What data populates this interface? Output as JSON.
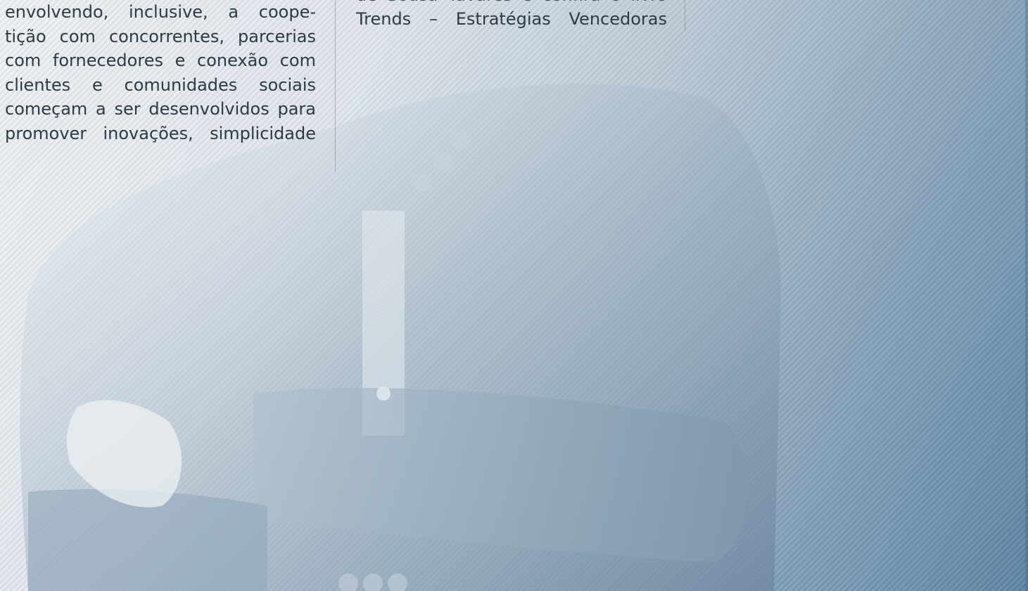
{
  "left_column": {
    "lines": [
      "envolvendo, inclusive, a coope-",
      "tição com concorrentes, parcerias",
      "com fornecedores e conexão com",
      "clientes e comunidades sociais",
      "começam a ser desenvolvidos para",
      "promover inovações, simplicidade"
    ]
  },
  "right_column": {
    "partial_top_line": "de Sousa Tavares e confira o livro",
    "lines": [
      "Trends – Estratégias Vencedoras"
    ]
  },
  "colors": {
    "text": "#2f3a44",
    "background_light": "#eef2f5",
    "background_dark": "#5f86a6"
  }
}
